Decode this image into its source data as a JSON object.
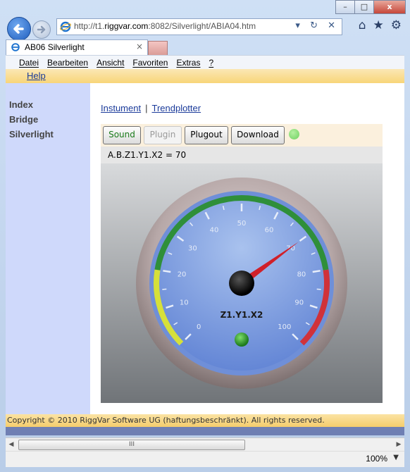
{
  "window": {
    "minimize": "–",
    "maximize": "□",
    "close": "x"
  },
  "address": {
    "url_prefix": "http://t1.",
    "url_host": "riggvar.com",
    "url_suffix": ":8082/Silverlight/ABIA04.htm",
    "tools": "▾ ↻ ✕"
  },
  "tab": {
    "title": "AB06 Silverlight",
    "close": "×"
  },
  "menu": [
    "Datei",
    "Bearbeiten",
    "Ansicht",
    "Favoriten",
    "Extras",
    "?"
  ],
  "help_link": "Help",
  "sidebar": [
    "Index",
    "Bridge",
    "Silverlight"
  ],
  "links": {
    "instrument": "Instument",
    "separator": "|",
    "trendplotter": "Trendplotter"
  },
  "toolbar": {
    "sound": "Sound",
    "plugin": "Plugin",
    "plugout": "Plugout",
    "download": "Download",
    "led_color": "#6ed060"
  },
  "readout": "A.B.Z1.Y1.X2 = 70",
  "gauge": {
    "label": "Z1.Y1.X2",
    "value": 70,
    "min": 0,
    "max": 100,
    "ticks": [
      "0",
      "10",
      "20",
      "30",
      "40",
      "50",
      "60",
      "70",
      "80",
      "90",
      "100"
    ],
    "bands": [
      {
        "from": 0,
        "to": 20,
        "color": "#d6e03a"
      },
      {
        "from": 20,
        "to": 80,
        "color": "#2f8f3a"
      },
      {
        "from": 80,
        "to": 100,
        "color": "#d0323a"
      }
    ]
  },
  "footer": "Copyright © 2010 RiggVar Software UG (haftungsbeschränkt). All rights reserved.",
  "scrollbar": {
    "left": "◀",
    "right": "▶",
    "grip": "III"
  },
  "status": {
    "zoom": "100%",
    "zoom_menu": "▼"
  }
}
